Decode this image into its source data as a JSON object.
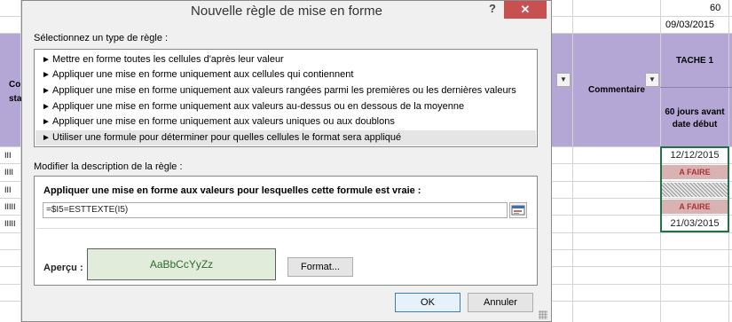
{
  "dialog": {
    "title": "Nouvelle règle de mise en forme",
    "help": "?",
    "close": "✕",
    "select_type_label": "Sélectionnez un type de règle :",
    "rule_arrow": "►",
    "rules": [
      "Mettre en forme toutes les cellules d'après leur valeur",
      "Appliquer une mise en forme uniquement aux cellules qui contiennent",
      "Appliquer une mise en forme uniquement aux valeurs rangées parmi les premières ou les dernières valeurs",
      "Appliquer une mise en forme uniquement aux valeurs au-dessus ou en dessous de la moyenne",
      "Appliquer une mise en forme uniquement aux valeurs uniques ou aux doublons",
      "Utiliser une formule pour déterminer pour quelles cellules le format sera appliqué"
    ],
    "selected_rule_index": 5,
    "modify_label": "Modifier la description de la règle :",
    "formula_label": "Appliquer une mise en forme aux valeurs pour lesquelles cette formule est vraie :",
    "formula_value": "=$I5=ESTTEXTE(I5)",
    "preview_label": "Aperçu :",
    "preview_text": "AaBbCcYyZz",
    "format_button": "Format...",
    "ok_button": "OK",
    "cancel_button": "Annuler"
  },
  "sheet": {
    "top_value": "60",
    "top_date": "09/03/2015",
    "left_header_1": "Co",
    "left_header_2": "sta",
    "commentaire_header": "Commentaire",
    "tache_header": "TACHE 1",
    "jours_header": "60 jours avant date début",
    "row_marks": [
      "III",
      "IIII",
      "III",
      "IIIII",
      "IIIII"
    ],
    "col_values": [
      {
        "type": "date",
        "text": "12/12/2015"
      },
      {
        "type": "afaire",
        "text": "A FAIRE"
      },
      {
        "type": "hatch",
        "text": ""
      },
      {
        "type": "afaire",
        "text": "A FAIRE"
      },
      {
        "type": "date",
        "text": "21/03/2015"
      }
    ]
  },
  "colors": {
    "header_purple": "#b4a7d6",
    "afaire_bg": "#d9b3b3",
    "afaire_text": "#aa3333",
    "preview_bg": "#e2ecda",
    "close_red": "#c75050"
  }
}
